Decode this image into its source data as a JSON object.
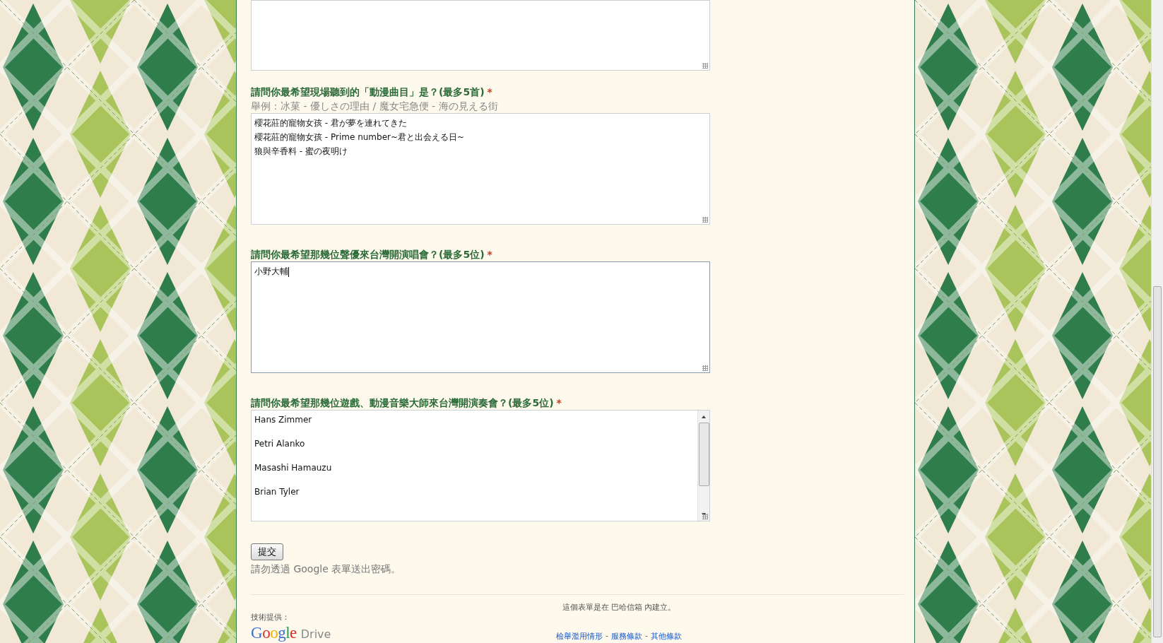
{
  "questions": [
    {
      "kind": "cut",
      "scrollable": false,
      "focused": false
    },
    {
      "kind": "text",
      "label": "請問你最希望現場聽到的「動漫曲目」是？(最多5首)",
      "required_mark": "*",
      "hint": "舉例：冰菓 - 優しさの理由 / 魔女宅急便 - 海の見える街",
      "answer_lines": [
        "櫻花莊的寵物女孩 - 君が夢を連れてきた",
        "櫻花莊的寵物女孩 - Prime number~君と出会える日~",
        "狼與辛香料 - 蜜の夜明け"
      ],
      "scrollable": false,
      "focused": false
    },
    {
      "kind": "text",
      "label": "請問你最希望那幾位聲優來台灣開演唱會？(最多5位)",
      "required_mark": "*",
      "answer_lines": [
        "小野大輔"
      ],
      "scrollable": false,
      "focused": true
    },
    {
      "kind": "text",
      "label": "請問你最希望那幾位遊戲、動漫音樂大師來台灣開演奏會？(最多5位)",
      "required_mark": "*",
      "answer_lines": [
        "Hans Zimmer",
        "Petri Alanko",
        "Masashi Hamauzu",
        "Brian Tyler"
      ],
      "scrollable": true,
      "focused": false
    }
  ],
  "submit_button": "提交",
  "password_note": "請勿透過 Google 表單送出密碼。",
  "footer": {
    "created_note": "這個表單是在 巴哈信箱 內建立。",
    "powered_by": "技術提供：",
    "logo": {
      "brand": "Google",
      "product": "Drive"
    },
    "links": [
      {
        "label": "檢舉濫用情形"
      },
      {
        "label": "服務條款"
      },
      {
        "label": "其他條款"
      }
    ],
    "separator": "-"
  }
}
